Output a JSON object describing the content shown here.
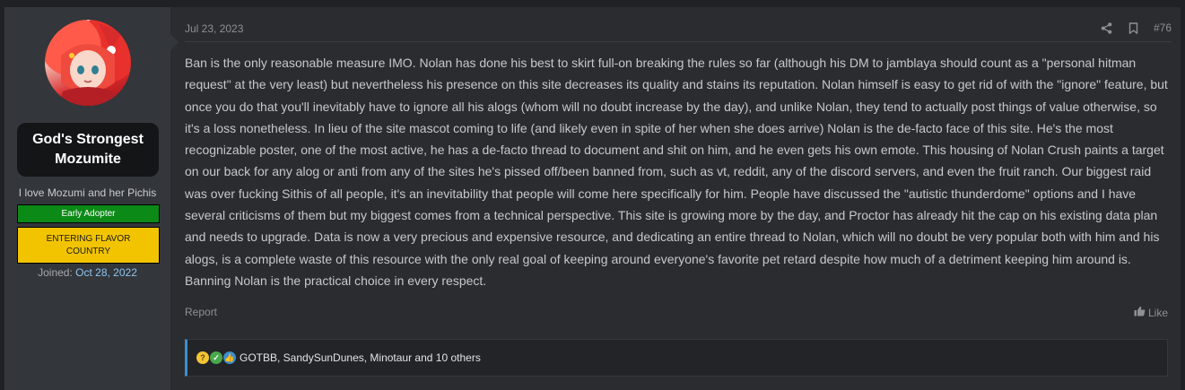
{
  "user": {
    "name": "God's Strongest Mozumite",
    "title": "I love Mozumi and her Pichis",
    "banners": [
      "Early Adopter",
      "ENTERING FLAVOR COUNTRY"
    ],
    "joined_label": "Joined:",
    "joined_date": "Oct 28, 2022"
  },
  "post": {
    "date": "Jul 23, 2023",
    "number": "#76",
    "body": "Ban is the only reasonable measure IMO. Nolan has done his best to skirt full-on breaking the rules so far (although his DM to jamblaya should count as a \"personal hitman request\" at the very least) but nevertheless his presence on this site decreases its quality and stains its reputation. Nolan himself is easy to get rid of with the \"ignore\" feature, but once you do that you'll inevitably have to ignore all his alogs (whom will no doubt increase by the day), and unlike Nolan, they tend to actually post things of value otherwise, so it's a loss nonetheless. In lieu of the site mascot coming to life (and likely even in spite of her when she does arrive) Nolan is the de-facto face of this site. He's the most recognizable poster, one of the most active, he has a de-facto thread to document and shit on him, and he even gets his own emote. This housing of Nolan Crush paints a target on our back for any alog or anti from any of the sites he's pissed off/been banned from, such as vt, reddit, any of the discord servers, and even the fruit ranch. Our biggest raid was over fucking Sithis of all people, it's an inevitability that people will come here specifically for him. People have discussed the \"autistic thunderdome\" options and I have several criticisms of them but my biggest comes from a technical perspective. This site is growing more by the day, and Proctor has already hit the cap on his existing data plan and needs to upgrade. Data is now a very precious and expensive resource, and dedicating an entire thread to Nolan, which will no doubt be very popular both with him and his alogs, is a complete waste of this resource with the only real goal of keeping around everyone's favorite pet retard despite how much of a detriment keeping him around is. Banning Nolan is the practical choice in every respect.",
    "report_label": "Report",
    "like_label": "Like"
  },
  "reactions": {
    "icons": [
      "thinking-face-icon",
      "check-mark-icon",
      "thumbs-up-icon"
    ],
    "text": "GOTBB, SandySunDunes, Minotaur and 10 others"
  },
  "colors": {
    "accent": "#3b8fd0",
    "banner_green": "#0b8a17",
    "banner_yellow": "#f2c400",
    "joined_date": "#8fc6f0"
  }
}
